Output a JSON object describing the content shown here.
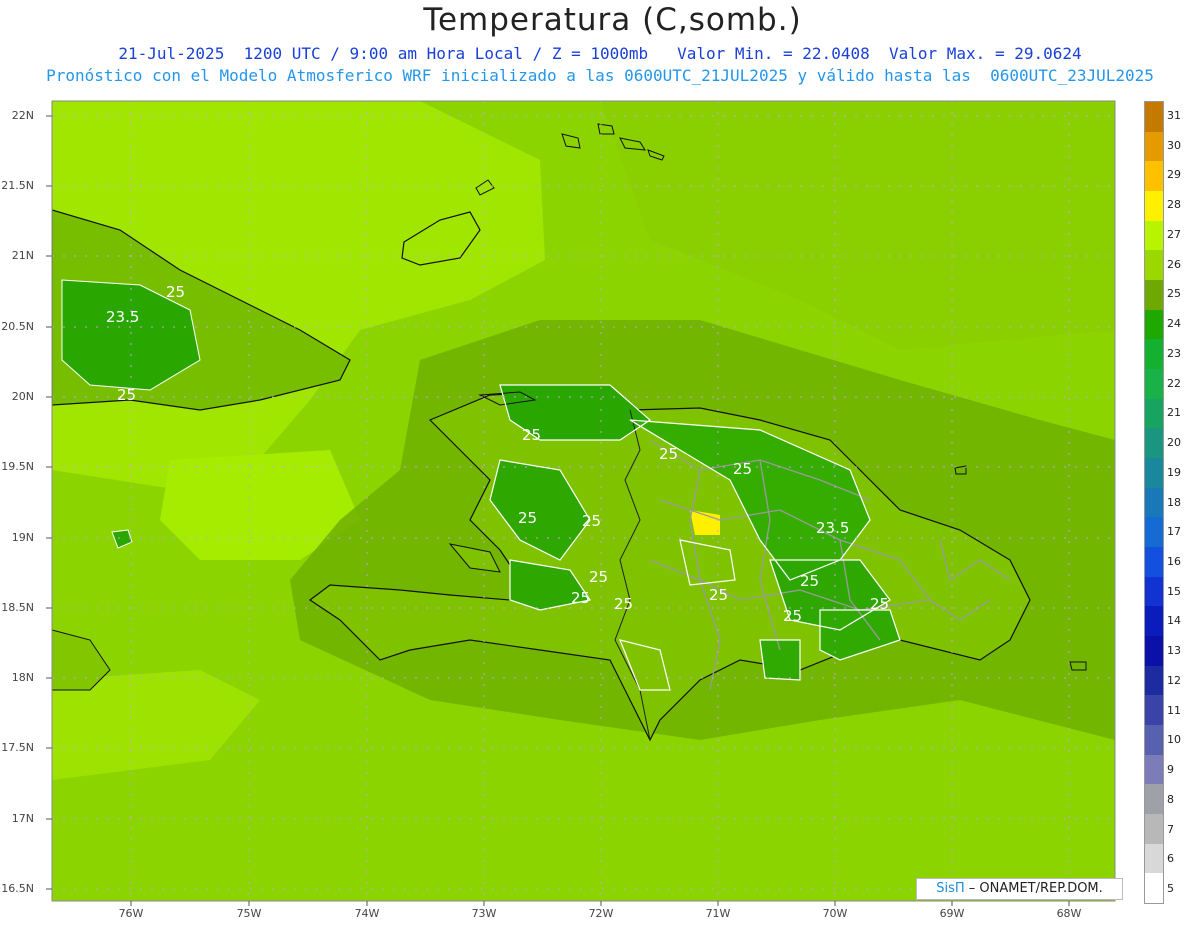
{
  "header": {
    "title": "Temperatura (C,somb.)",
    "subtitle": "21-Jul-2025  1200 UTC / 9:00 am Hora Local / Z = 1000mb   Valor Min. = 22.0408  Valor Max. = 29.0624",
    "forecast": "Pronóstico con el Modelo Atmosferico WRF inicializado a las 0600UTC_21JUL2025 y válido hasta las  0600UTC_23JUL2025"
  },
  "axes": {
    "lat_labels": [
      "22N",
      "21.5N",
      "21N",
      "20.5N",
      "20N",
      "19.5N",
      "19N",
      "18.5N",
      "18N",
      "17.5N",
      "17N",
      "16.5N"
    ],
    "lon_labels": [
      "76W",
      "75W",
      "74W",
      "73W",
      "72W",
      "71W",
      "70W",
      "69W",
      "68W"
    ]
  },
  "colorbar": {
    "labels": [
      "31",
      "30",
      "29",
      "28",
      "27",
      "26",
      "25",
      "24",
      "23",
      "22",
      "21",
      "20",
      "19",
      "18",
      "17",
      "16",
      "15",
      "14",
      "13",
      "12",
      "11",
      "10",
      "9",
      "8",
      "7",
      "6",
      "5"
    ],
    "colors": [
      "#c47a00",
      "#e49a00",
      "#ffc000",
      "#fff000",
      "#b8f400",
      "#9ad800",
      "#6fa800",
      "#1fa800",
      "#14b030",
      "#18b248",
      "#16a460",
      "#1a9680",
      "#1a889c",
      "#1878b8",
      "#166ad4",
      "#1450e0",
      "#1232d2",
      "#0c1cbc",
      "#0a10a8",
      "#1e2aa0",
      "#3a44a8",
      "#5860b0",
      "#7c7cb8",
      "#a0a0a8",
      "#b8b8b8",
      "#d8d8d8",
      "#ffffff"
    ]
  },
  "contour_labels": [
    "23.5",
    "25",
    "25",
    "25",
    "25",
    "25",
    "25",
    "25",
    "25",
    "25",
    "25",
    "23.5",
    "25",
    "25",
    "25",
    "25"
  ],
  "credit": {
    "brand": "SisΠ",
    "text": "– ONAMET/REP.DOM."
  }
}
